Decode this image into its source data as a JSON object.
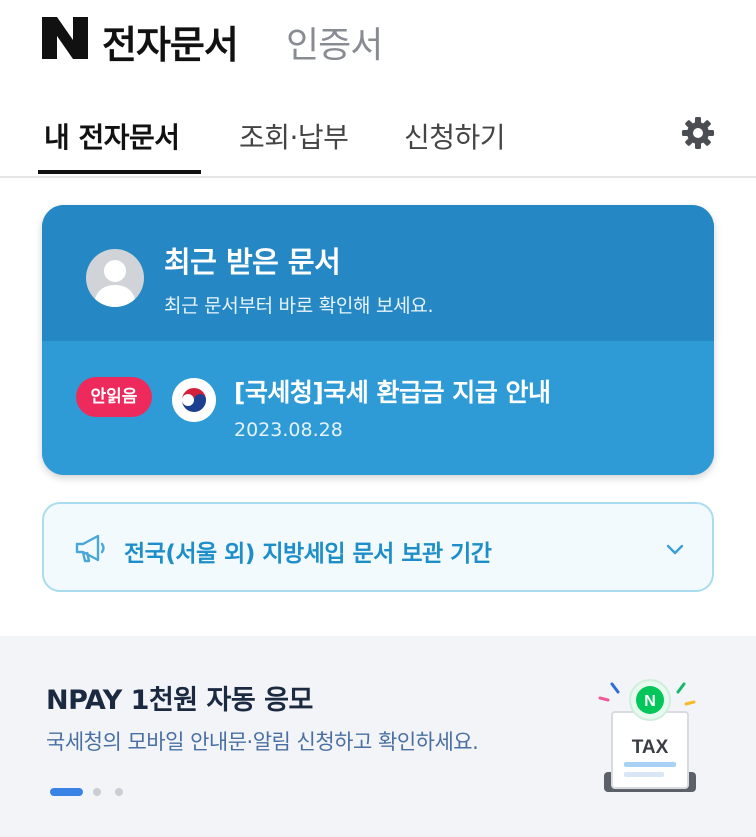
{
  "header": {
    "logo_letter": "N",
    "title": "전자문서",
    "subtitle": "인증서"
  },
  "tabs": [
    {
      "label": "내 전자문서",
      "active": true
    },
    {
      "label": "조회·납부",
      "active": false
    },
    {
      "label": "신청하기",
      "active": false
    }
  ],
  "settings_icon": "gear-icon",
  "recent": {
    "title": "최근 받은 문서",
    "subtitle": "최근 문서부터 바로 확인해 보세요.",
    "badge": "안읽음",
    "doc_title": "[국세청]국세 환급금 지급 안내",
    "doc_date": "2023.08.28"
  },
  "notice": {
    "icon": "megaphone-icon",
    "text": "전국(서울 외) 지방세입 문서 보관 기간"
  },
  "banner": {
    "title": "NPAY 1천원 자동 응모",
    "subtitle": "국세청의 모바일 안내문·알림 신청하고 확인하세요.",
    "illustration_text": "TAX",
    "illustration_badge": "N",
    "page_count": 3,
    "current_page": 1
  },
  "colors": {
    "card_top": "#2588c4",
    "card_bottom": "#2e9bd6",
    "badge": "#ee2a5c",
    "notice_text": "#1e8ec9",
    "naver_green": "#03c75a"
  }
}
